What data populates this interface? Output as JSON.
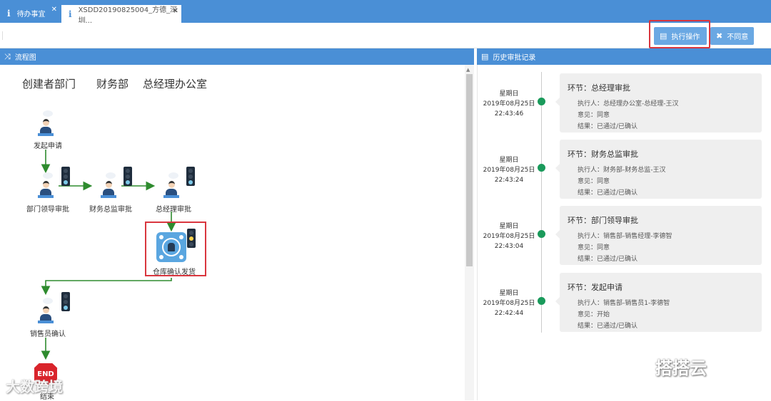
{
  "tabs": [
    {
      "label": "待办事宜",
      "close": "✕"
    },
    {
      "label": "XSDD20190825004_方德_深圳...",
      "close": "✕"
    }
  ],
  "toolbar": {
    "execute_label": "执行操作",
    "reject_label": "不同意"
  },
  "flow_panel": {
    "title": "流程图",
    "lanes": [
      "创建者部门",
      "财务部",
      "总经理办公室"
    ],
    "nodes": {
      "start": "发起申请",
      "dept_leader": "部门领导审批",
      "finance": "财务总监审批",
      "gm": "总经理审批",
      "warehouse": "仓库确认发货",
      "sales": "销售员确认",
      "end_sign": "END",
      "end": "结束"
    }
  },
  "history_panel": {
    "title": "历史审批记录",
    "records": [
      {
        "weekday": "星期日",
        "date": "2019年08月25日",
        "time": "22:43:46",
        "step": "环节：总经理审批",
        "executor": "执行人：总经理办公室-总经理-王汉",
        "opinion": "意见：同意",
        "result": "结果：已通过/已确认"
      },
      {
        "weekday": "星期日",
        "date": "2019年08月25日",
        "time": "22:43:24",
        "step": "环节：财务总监审批",
        "executor": "执行人：财务部-财务总监-王汉",
        "opinion": "意见：同意",
        "result": "结果：已通过/已确认"
      },
      {
        "weekday": "星期日",
        "date": "2019年08月25日",
        "time": "22:43:04",
        "step": "环节：部门领导审批",
        "executor": "执行人：销售部-销售经理-李德智",
        "opinion": "意见：同意",
        "result": "结果：已通过/已确认"
      },
      {
        "weekday": "星期日",
        "date": "2019年08月25日",
        "time": "22:42:44",
        "step": "环节：发起申请",
        "executor": "执行人：销售部-销售员1-李德智",
        "opinion": "意见：开始",
        "result": "结果：已通过/已确认"
      }
    ]
  },
  "watermarks": {
    "left": "大数跨境",
    "right": "搭搭云"
  },
  "colors": {
    "header_blue": "#4a8fd6",
    "button_blue": "#6aa8e3",
    "highlight_red": "#d9363e",
    "flow_green": "#2e8b2e",
    "timeline_green": "#1a9a5b"
  }
}
